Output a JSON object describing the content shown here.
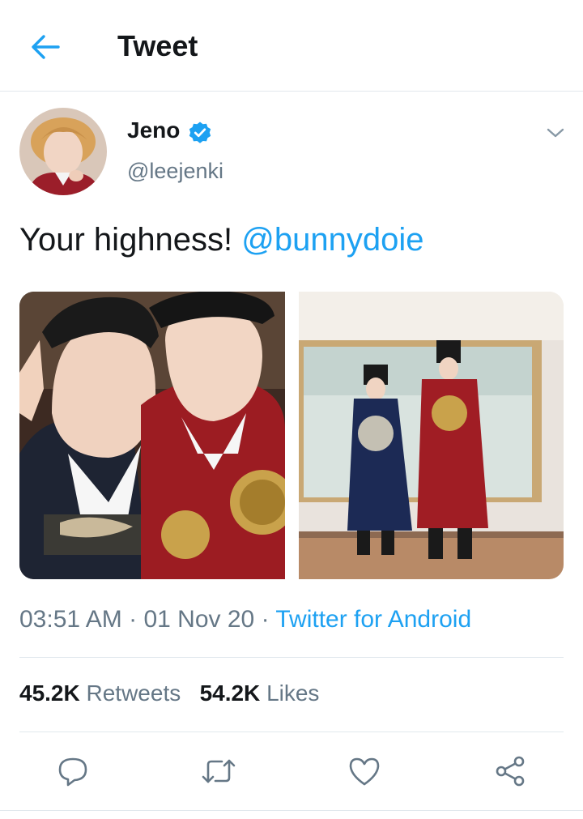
{
  "header": {
    "title": "Tweet",
    "back_icon": "arrow-left-icon"
  },
  "colors": {
    "accent": "#1da1f2",
    "text": "#14171a",
    "muted": "#657786",
    "divider": "#e1e8ed"
  },
  "tweet": {
    "author": {
      "display_name": "Jeno",
      "handle": "@leejenki",
      "verified": true
    },
    "text": "Your highness!",
    "mention": "@bunnydoie",
    "photos": [
      {
        "description": "selfie-photo"
      },
      {
        "description": "full-length-photo"
      }
    ],
    "timestamp": "03:51 AM",
    "separator": "·",
    "date": "01 Nov 20",
    "source": "Twitter for Android",
    "retweets_count": "45.2K",
    "retweets_label": "Retweets",
    "likes_count": "54.2K",
    "likes_label": "Likes"
  },
  "actions": [
    {
      "icon": "reply-icon"
    },
    {
      "icon": "retweet-icon"
    },
    {
      "icon": "like-icon"
    },
    {
      "icon": "share-icon"
    }
  ]
}
